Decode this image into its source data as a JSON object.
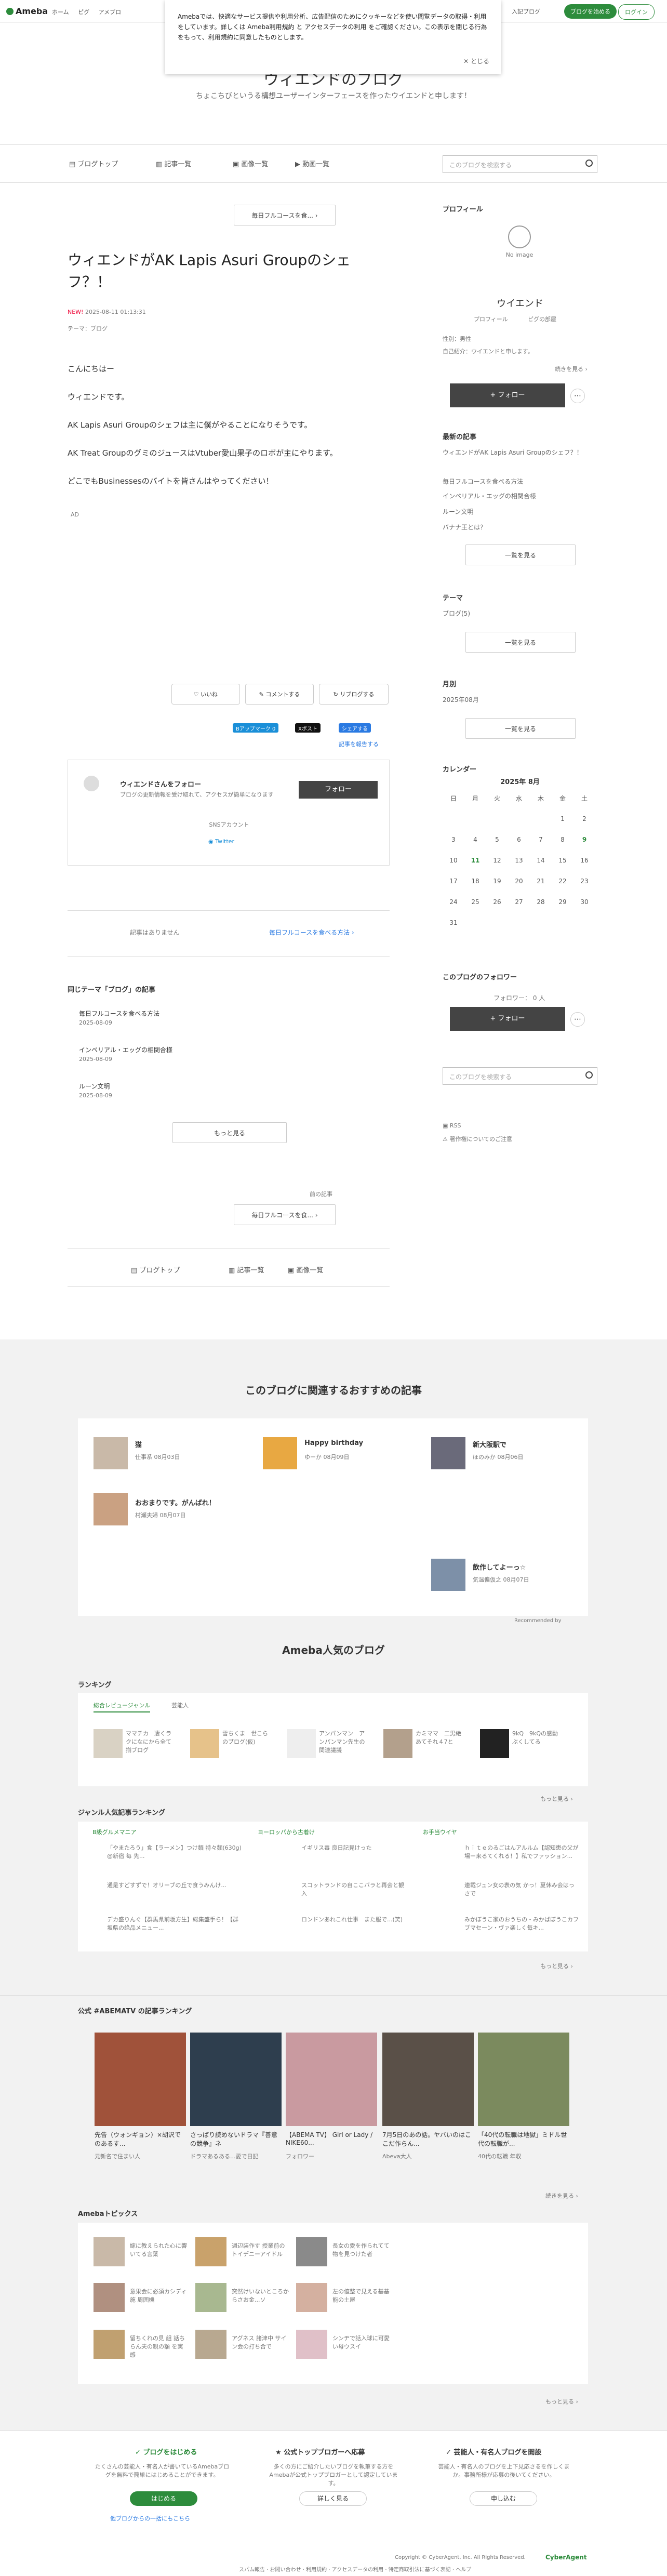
{
  "topbar": {
    "logo": "Ameba",
    "crumbs": [
      "ホーム",
      "ピグ",
      "アメブロ"
    ],
    "start_blog": "ブログを始める",
    "login": "ログイン",
    "write": "入記ブログ"
  },
  "cookie": {
    "text": "Amebaでは、快適なサービス提供や利用分析、広告配信のためにクッキーなどを使い閲覧データの取得・利用をしています。詳しくは Ameba利用規約 と アクセスデータの利用 をご確認ください。この表示を閉じる行為をもって、利用規約に同意したものとします。",
    "close": "とじる"
  },
  "blog": {
    "title": "ウィエンドのブログ",
    "subtitle": "ちょこちびというる構想ユーザーインターフェースを作ったウイエンドと申します！"
  },
  "nav": {
    "items": [
      "ブログトップ",
      "記事一覧",
      "画像一覧",
      "動画一覧"
    ],
    "search_placeholder": "このブログを検索する"
  },
  "article": {
    "prev_btn": "毎日フルコースを食...",
    "title": "ウィエンドがAK Lapis Asuri Groupのシェフ？！",
    "new": "NEW!",
    "date": "2025-08-11 01:13:31",
    "theme": "テーマ：ブログ",
    "paragraphs": [
      "こんにちはー",
      "ウィエンドです。",
      "AK Lapis Asuri Groupのシェフは主に僕がやることになりそうです。",
      "AK Treat GroupのグミのジュースはVtuber愛山果子のロボが主にやります。",
      "どこでもBusinessesのバイトを皆さんはやってください！"
    ],
    "ad": "AD",
    "like": "いいね",
    "comment": "コメントする",
    "reblog": "リブログする",
    "bookmark": "Bアップマーク 0",
    "x_post": "Xポスト",
    "share": "シェアする",
    "notify": "記事を報告する",
    "follow_card": {
      "title": "ウィエンドさんをフォロー",
      "desc": "ブログの更新情報を受け取れて、アクセスが簡単になります",
      "btn": "フォロー",
      "sns": "SNSアカウント",
      "twitter": "Twitter"
    },
    "no_prev": "記事はありません",
    "next": "毎日フルコースを食べる方法"
  },
  "same_theme": {
    "title": "同じテーマ「ブログ」の記事",
    "items": [
      {
        "t": "毎日フルコースを食べる方法",
        "d": "2025-08-09"
      },
      {
        "t": "インペリアル・エッグの相関合様",
        "d": "2025-08-09"
      },
      {
        "t": "ルーン文明",
        "d": "2025-08-09"
      }
    ],
    "more": "もっと見る",
    "prev_label": "前の記事",
    "prev": "毎日フルコースを食..."
  },
  "bottomnav": [
    "ブログトップ",
    "記事一覧",
    "画像一覧"
  ],
  "side": {
    "profile": "プロフィール",
    "noimage": "No image",
    "name": "ウイエンド",
    "links": [
      "プロフィール",
      "ピグの部屋"
    ],
    "gender": "性別：男性",
    "intro": "自己紹介：ウイエンドと申します。",
    "more": "続きを見る",
    "follow": "+ フォロー",
    "recent": "最新の記事",
    "recent_items": [
      "ウィエンドがAK Lapis Asuri Groupのシェフ？！",
      "毎日フルコースを食べる方法",
      "インペリアル・エッグの相関合様",
      "ルーン文明",
      "バナナ王とは？"
    ],
    "list": "一覧を見る",
    "theme": "テーマ",
    "theme_items": [
      "ブログ(5)"
    ],
    "month": "月別",
    "month_items": [
      "2025年08月"
    ],
    "calendar": "カレンダー",
    "cal_title": "2025年 8月",
    "weekdays": [
      "日",
      "月",
      "火",
      "水",
      "木",
      "金",
      "土"
    ],
    "weeks": [
      [
        "",
        "",
        "",
        "",
        "",
        "1",
        "2"
      ],
      [
        "3",
        "4",
        "5",
        "6",
        "7",
        "8",
        "9"
      ],
      [
        "10",
        "11",
        "12",
        "13",
        "14",
        "15",
        "16"
      ],
      [
        "17",
        "18",
        "19",
        "20",
        "21",
        "22",
        "23"
      ],
      [
        "24",
        "25",
        "26",
        "27",
        "28",
        "29",
        "30"
      ],
      [
        "31",
        "",
        "",
        "",
        "",
        "",
        ""
      ]
    ],
    "followers": "このブログのフォロワー",
    "fcount": "フォロワー： 0 人",
    "rss": "RSS",
    "report": "著作権についてのご注意"
  },
  "reco": {
    "title": "このブログに関連するおすすめの記事",
    "items": [
      {
        "t": "猫",
        "a": "仕事系",
        "d": "08月03日"
      },
      {
        "t": "Happy birthday",
        "a": "ゆーか",
        "d": "08月09日"
      },
      {
        "t": "新大阪駅で",
        "a": "ほのみか",
        "d": "08月06日"
      },
      {
        "t": "おおまりです。がんばれ！",
        "a": "村瀬夫婦",
        "d": "08月07日"
      },
      {
        "t": "飲作してよーっ☆",
        "a": "気温偏仮之",
        "d": "08月07日"
      }
    ],
    "powered": "Recommended by"
  },
  "popular": {
    "title": "Ameba人気のブログ",
    "ranking": "ランキング",
    "tabs": [
      "総合レビュージャンル",
      "芸能人"
    ],
    "items": [
      "ママチカ　凄くラクになにから全て揃ブログ",
      "雪ちくま　世こらのブログ(仮)",
      "アンパンマン　アンパンマン先生の関連議議",
      "カミママ　二男絶あてそれ４7と",
      "9kQ　9kQの感動ぶくしてる"
    ],
    "more": "もっと見る",
    "genre": "ジャンル人気記事ランキング",
    "genre_cols": [
      {
        "head": "B級グルメマニア",
        "items": [
          "「やまたろう」食【ラーメン】つけ麺 特々麺(630g) @新宿 毎 先...",
          "通是すどすずで！オリーブの丘で食うみんけ...",
          "デカ盛りんぐ【群馬県前坂方生】総集盛手ら！【群坂県の絶品メニュー..."
        ]
      },
      {
        "head": "ヨーロッパから古着け",
        "items": [
          "イギリス毒 良日記見けった",
          "スコットランドの自ここバラと再会と観入",
          "ロンドンあれこれ仕事　また服で...(笑)"
        ]
      },
      {
        "head": "お手当ウイヤ",
        "items": [
          "ｈｉｔｅのるごはんアルルム【認知患の父が場ー来るてくれる！】私でファッション...",
          "連載ジュン女の表の気 かっ！夏休み会はっさで",
          "みかぼうこ家のおうちの・みかばぼうこカフブマセーン・ヴァ楽しく毎キ..."
        ]
      }
    ],
    "more2": "もっと見る"
  },
  "abematv": {
    "title": "公式 #ABEMATV の記事ランキング",
    "items": [
      {
        "t": "先告（ウォンギョン）×胡沢でのあるす...",
        "a": "元新名で住まい人"
      },
      {
        "t": "さっぱり読めないドラマ『善意の競争』ネ",
        "a": "ドラマあるある...愛で日記"
      },
      {
        "t": "【ABEMA TV】 Girl or Lady / NIKE60...",
        "a": "フォロワー"
      },
      {
        "t": "7月5日のあの話。ヤバいのはここだ作らん...",
        "a": "Abeva大人"
      },
      {
        "t": "「40代の転職は地獄」ミドル世代の転職が...",
        "a": "40代の転職 年収"
      }
    ],
    "more": "続きを見る"
  },
  "topics": {
    "title": "Amebaトピックス",
    "items": [
      "嫁に教えられた心に響いてる言葉",
      "週辺装作す 授業前のトイデニーアイドル",
      "長女の愛を作られてて物を見つけた者",
      "意果会に必須カシディ施 周囲機",
      "突然けいないところからさお金...ソ",
      "左の値整で見える基基能の土屋",
      "留ちくれの見 組 話ちらん夫の親の額 を実感",
      "アグネス 諸津中 サイン会の打ち合で",
      "シンヂで話入球に可愛い母ウスイ"
    ],
    "more": "もっと見る"
  },
  "footer": {
    "cols": [
      {
        "h": "ブログをはじめる",
        "t": "たくさんの芸能人・有名人が書いているAmebaブログを無料で簡単にはじめることができます。",
        "b": "はじめる",
        "l": "他ブログからの一括にもこちら"
      },
      {
        "h": "公式トップブロガーへ応募",
        "t": "多くの方にご紹介したいブログを執筆する方をAmebaが公式トップブロガーとして認定しています。",
        "b": "詳しく見る"
      },
      {
        "h": "芸能人・有名人ブログを開設",
        "t": "芸能人・有名人のブログを上下見応さるを作しくまか。事務所様が応募の後いてください。",
        "b": "申し込む"
      }
    ],
    "copyright": "Copyright © CyberAgent, Inc. All Rights Reserved.",
    "links": [
      "スパム報告",
      "お問い合わせ",
      "利用規約",
      "アクセスデータの利用",
      "特定商取引法に基づく表記",
      "ヘルプ"
    ],
    "ca": "CyberAgent"
  }
}
